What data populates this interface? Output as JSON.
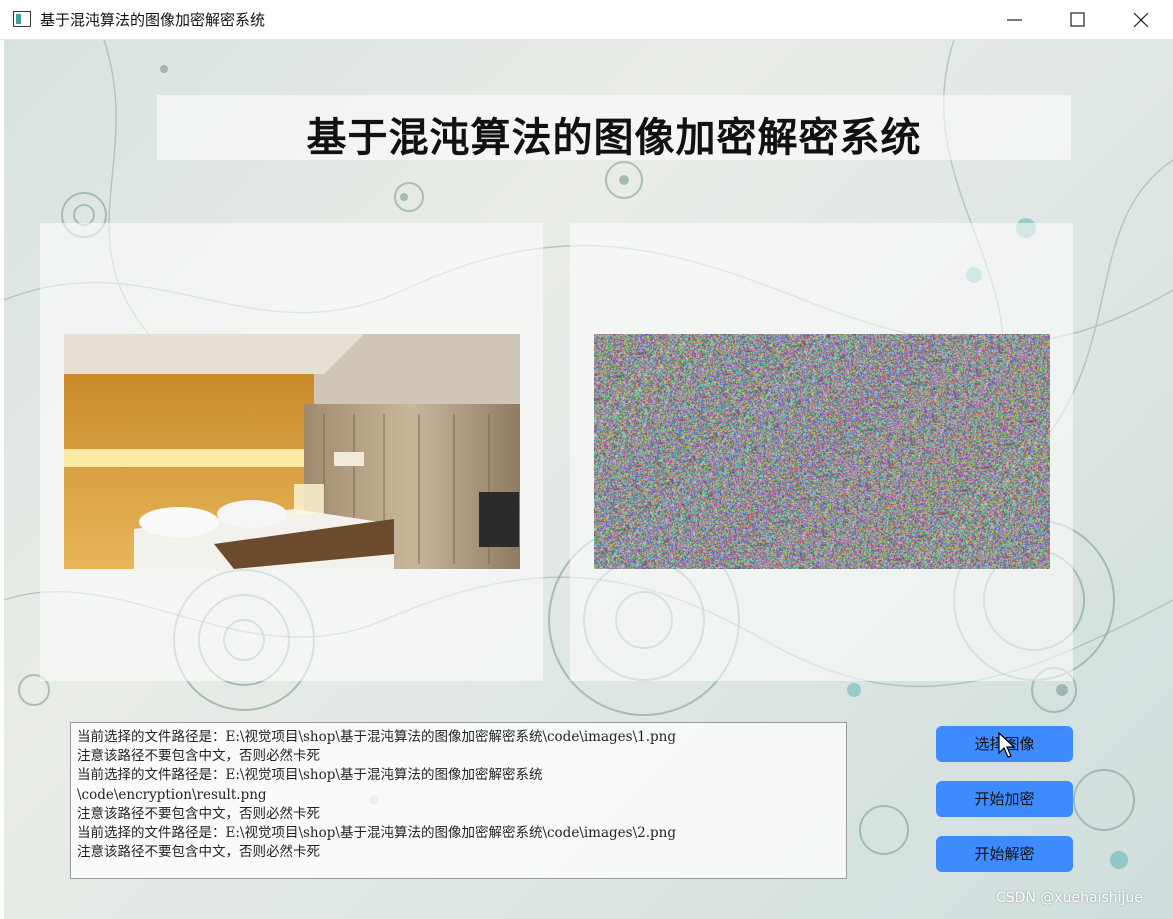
{
  "window": {
    "title": "基于混沌算法的图像加密解密系统",
    "controls": [
      "minimize-icon",
      "maximize-icon",
      "close-icon"
    ]
  },
  "main": {
    "heading": "基于混沌算法的图像加密解密系统",
    "left_image": "bedroom-photo",
    "right_image": "encrypted-noise"
  },
  "log": {
    "lines": [
      "当前选择的文件路径是：E:\\视觉项目\\shop\\基于混沌算法的图像加密解密系统\\code\\images\\1.png",
      "注意该路径不要包含中文，否则必然卡死",
      "当前选择的文件路径是：E:\\视觉项目\\shop\\基于混沌算法的图像加密解密系统",
      "\\code\\encryption\\result.png",
      "注意该路径不要包含中文，否则必然卡死",
      "当前选择的文件路径是：E:\\视觉项目\\shop\\基于混沌算法的图像加密解密系统\\code\\images\\2.png",
      "注意该路径不要包含中文，否则必然卡死"
    ]
  },
  "buttons": {
    "select": "选择图像",
    "encrypt": "开始加密",
    "decrypt": "开始解密"
  },
  "colors": {
    "button": "#3d8bff",
    "accent": "#3aa0a0"
  },
  "watermark": "CSDN @xuehaishijue"
}
